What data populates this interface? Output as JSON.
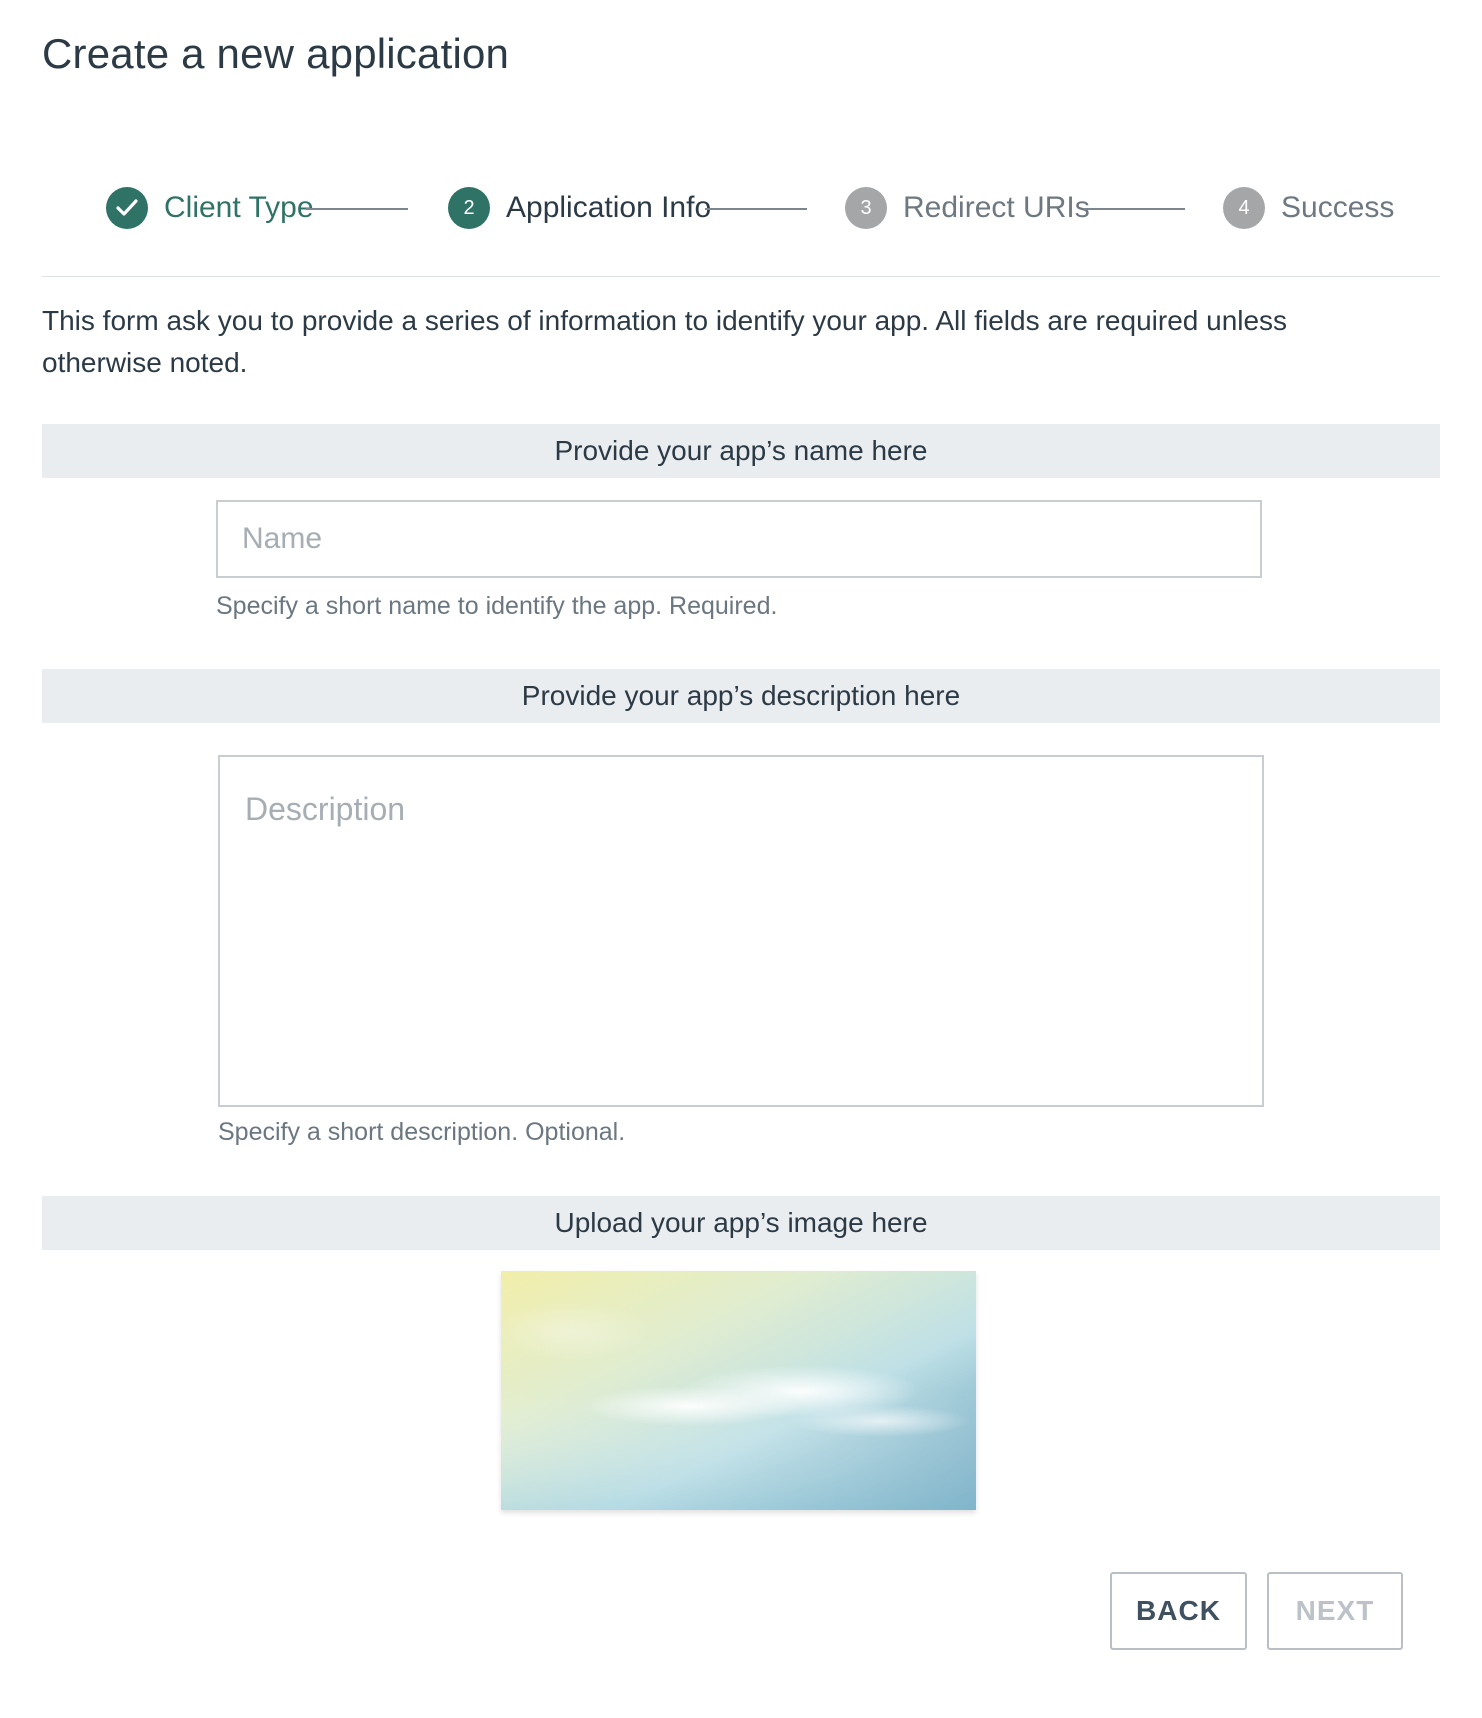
{
  "page": {
    "title": "Create a new application"
  },
  "stepper": {
    "steps": [
      {
        "label": "Client Type",
        "state": "complete",
        "icon": "check-icon"
      },
      {
        "number": "2",
        "label": "Application Info",
        "state": "active"
      },
      {
        "number": "3",
        "label": "Redirect URIs",
        "state": "pending"
      },
      {
        "number": "4",
        "label": "Success",
        "state": "pending"
      }
    ]
  },
  "intro": "This form ask you to provide a series of information to identify your app. All fields are required unless otherwise noted.",
  "name_section": {
    "header": "Provide your app’s name here",
    "placeholder": "Name",
    "value": "",
    "help": "Specify a short name to identify the app. Required."
  },
  "description_section": {
    "header": "Provide your app’s description here",
    "placeholder": "Description",
    "value": "",
    "help": "Specify a short description. Optional."
  },
  "image_section": {
    "header": "Upload your app’s image here",
    "image": "sky-cloud-image"
  },
  "actions": {
    "back_label": "BACK",
    "next_label": "NEXT",
    "next_disabled": true
  },
  "colors": {
    "accent": "#2f7366",
    "pending": "#a4a6a8",
    "section_bg": "#eaedf0",
    "text": "#2b3a45"
  }
}
